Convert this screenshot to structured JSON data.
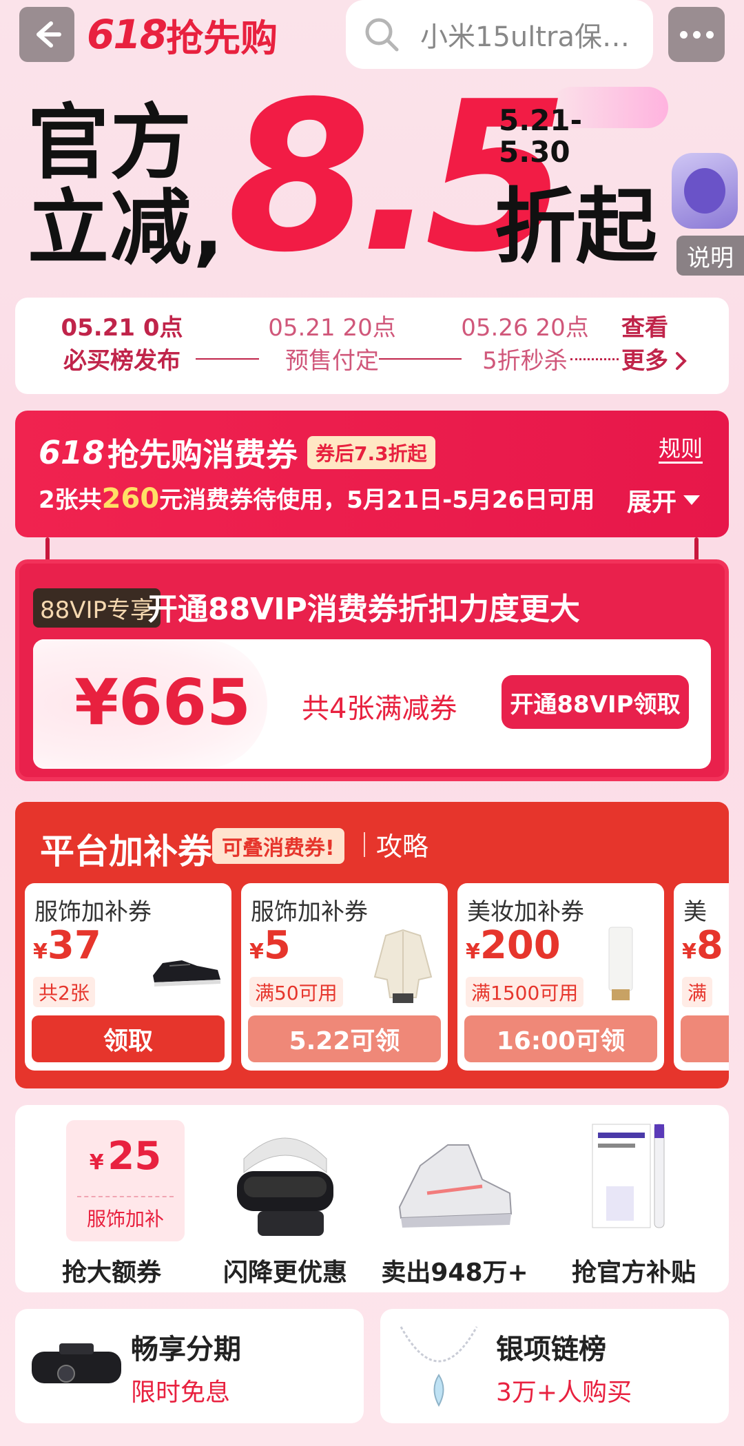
{
  "header": {
    "logo_num": "618",
    "logo_text": "抢先购",
    "search_text": "小米15ultra保…"
  },
  "hero": {
    "line1": "官方",
    "line2": "立减,",
    "discount": "8.5",
    "date_line1": "5.21-",
    "date_line2": "5.30",
    "suffix": "折起",
    "explain_label": "说明"
  },
  "timeline": {
    "steps": [
      {
        "date": "05.21 0点",
        "name": "必买榜发布"
      },
      {
        "date": "05.21 20点",
        "name": "预售付定"
      },
      {
        "date": "05.26 20点",
        "name": "5折秒杀"
      }
    ],
    "more_line1": "查看",
    "more_line2": "更多"
  },
  "consumer_coupon": {
    "title_num": "618",
    "title_text": "抢先购消费券",
    "badge": "券后7.3折起",
    "rule": "规则",
    "desc_pre": "2张共",
    "desc_amount": "260",
    "desc_post": "元消费券待使用，5月21日-5月26日可用",
    "expand": "展开"
  },
  "vip": {
    "badge": "88VIP专享",
    "title": "开通88VIP消费券折扣力度更大",
    "amount": "¥665",
    "desc": "共4张满减券",
    "button": "开通88VIP领取"
  },
  "platform": {
    "title": "平台加补券",
    "badge": "可叠消费券!",
    "guide": "攻略",
    "coupons": [
      {
        "name": "服饰加补券",
        "currency": "¥",
        "value": "37",
        "cond": "共2张",
        "button": "领取",
        "active": true
      },
      {
        "name": "服饰加补券",
        "currency": "¥",
        "value": "5",
        "cond": "满50可用",
        "button": "5.22可领",
        "active": false
      },
      {
        "name": "美妆加补券",
        "currency": "¥",
        "value": "200",
        "cond": "满1500可用",
        "button": "16:00可领",
        "active": false
      },
      {
        "name": "美",
        "currency": "¥",
        "value": "8",
        "cond": "满",
        "button": "",
        "active": false
      }
    ]
  },
  "icon_row": {
    "coupon_currency": "¥",
    "coupon_value": "25",
    "coupon_sub": "服饰加补",
    "items": [
      {
        "label": "抢大额券"
      },
      {
        "label": "闪降更优惠"
      },
      {
        "label": "卖出948万+"
      },
      {
        "label": "抢官方补贴"
      }
    ]
  },
  "bottom": [
    {
      "title": "畅享分期",
      "subtitle": "限时免息"
    },
    {
      "title": "银项链榜",
      "subtitle": "3万+人购买"
    }
  ],
  "colors": {
    "brand_red": "#e8213f",
    "platform_red": "#e6352c",
    "page_bg": "#fbe3ea"
  }
}
